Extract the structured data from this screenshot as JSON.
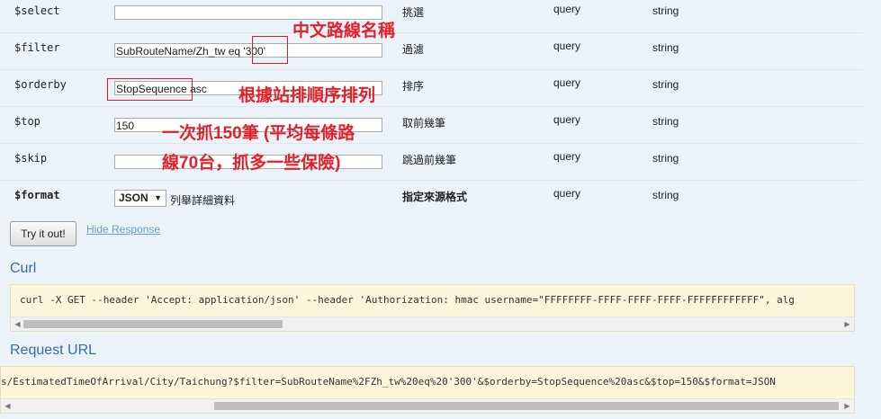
{
  "params": [
    {
      "name": "$select",
      "value": "",
      "description": "挑選",
      "param_type": "query",
      "data_type": "string"
    },
    {
      "name": "$filter",
      "value_prefix": "SubRouteName/Zh_tw eq ",
      "value_highlight": "'300'",
      "description": "過濾",
      "param_type": "query",
      "data_type": "string"
    },
    {
      "name": "$orderby",
      "value_highlight": "StopSequence",
      "value_suffix": " asc",
      "description": "排序",
      "param_type": "query",
      "data_type": "string"
    },
    {
      "name": "$top",
      "value": "150",
      "description": "取前幾筆",
      "param_type": "query",
      "data_type": "string"
    },
    {
      "name": "$skip",
      "value": "",
      "description": "跳過前幾筆",
      "param_type": "query",
      "data_type": "string"
    },
    {
      "name": "$format",
      "selected": "JSON",
      "note": "列舉詳細資料",
      "description": "指定來源格式",
      "param_type": "query",
      "data_type": "string"
    }
  ],
  "annotations": {
    "route_name": "中文路線名稱",
    "order_by_stop": "根據站排順序排列",
    "fetch_line1": "一次抓150筆 (平均每條路",
    "fetch_line2": "線70台，抓多一些保險)"
  },
  "actions": {
    "try_label": "Try it out!",
    "hide_label": "Hide Response"
  },
  "curl": {
    "heading": "Curl",
    "command": "curl -X GET --header 'Accept: application/json' --header 'Authorization: hmac username=\"FFFFFFFF-FFFF-FFFF-FFFF-FFFFFFFFFFFF\", alg"
  },
  "request_url": {
    "heading": "Request URL",
    "url": "s/EstimatedTimeOfArrival/City/Taichung?$filter=SubRouteName%2FZh_tw%20eq%20'300'&$orderby=StopSequence%20asc&$top=150&$format=JSON"
  }
}
